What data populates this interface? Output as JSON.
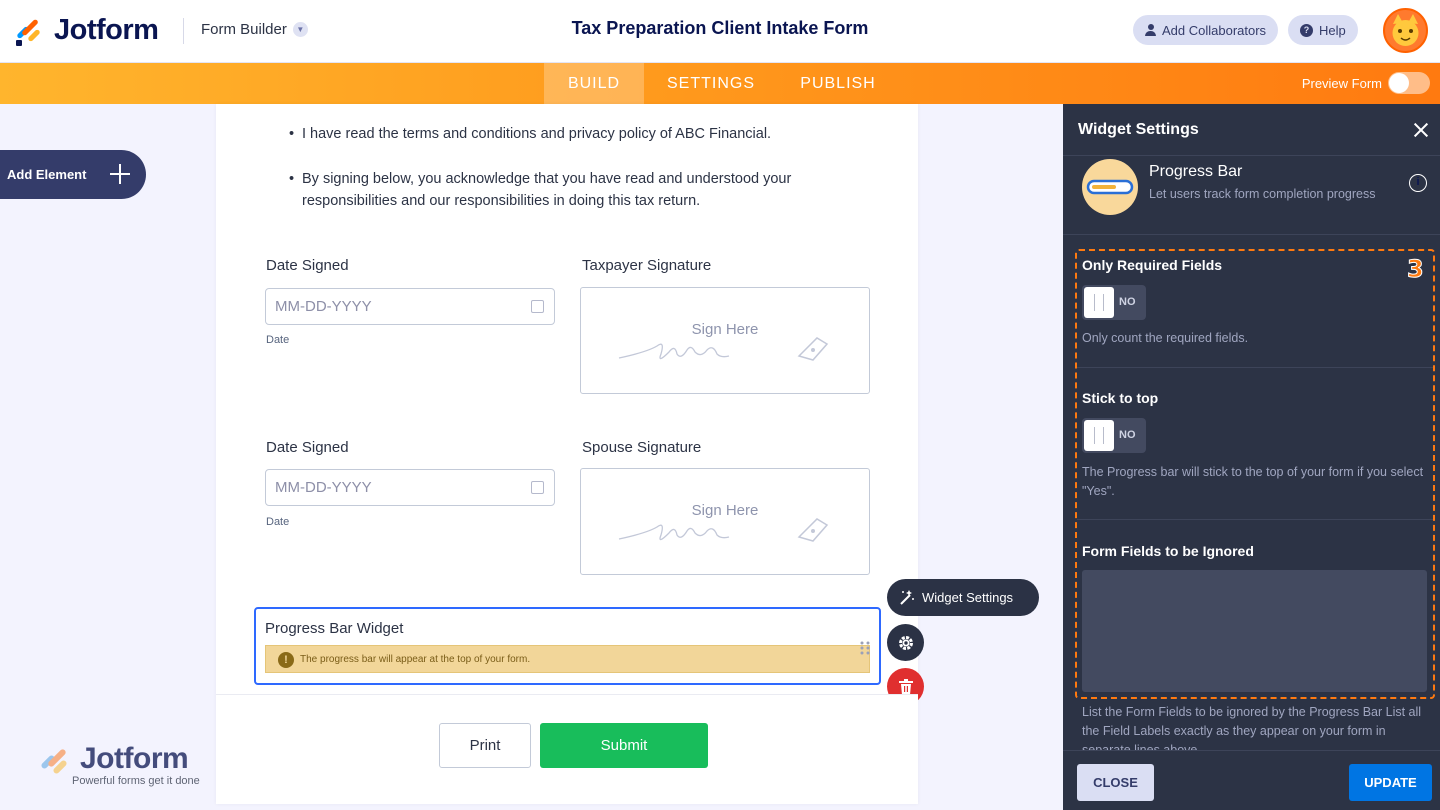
{
  "header": {
    "brand": "Jotform",
    "builder_label": "Form Builder",
    "form_title": "Tax Preparation Client Intake Form",
    "add_collaborators": "Add Collaborators",
    "help": "Help"
  },
  "nav": {
    "tabs": [
      "BUILD",
      "SETTINGS",
      "PUBLISH"
    ],
    "active_tab": "BUILD",
    "preview_label": "Preview Form"
  },
  "canvas": {
    "add_element": "Add Element",
    "bullets": [
      "I have read the terms and conditions and privacy policy of ABC Financial.",
      "By signing below, you acknowledge that you have read and understood your responsibilities and our responsibilities in doing this tax return."
    ],
    "rows": [
      {
        "date_label": "Date Signed",
        "date_placeholder": "MM-DD-YYYY",
        "date_sub": "Date",
        "sig_label": "Taxpayer Signature",
        "sig_placeholder": "Sign Here"
      },
      {
        "date_label": "Date Signed",
        "date_placeholder": "MM-DD-YYYY",
        "date_sub": "Date",
        "sig_label": "Spouse Signature",
        "sig_placeholder": "Sign Here"
      }
    ],
    "widget": {
      "title": "Progress Bar Widget",
      "warning": "The progress bar will appear at the top of your form.",
      "settings_button": "Widget Settings"
    },
    "print": "Print",
    "submit": "Submit",
    "watermark_brand": "Jotform",
    "watermark_tagline": "Powerful forms get it done"
  },
  "panel": {
    "title": "Widget Settings",
    "widget_name": "Progress Bar",
    "widget_desc": "Let users track form completion progress",
    "step_marker": "3",
    "settings": [
      {
        "label": "Only Required Fields",
        "toggle": "NO",
        "help": "Only count the required fields."
      },
      {
        "label": "Stick to top",
        "toggle": "NO",
        "help": "The Progress bar will stick to the top of your form if you select \"Yes\"."
      }
    ],
    "ignored_label": "Form Fields to be Ignored",
    "ignored_value": "",
    "ignored_help": "List the Form Fields to be ignored by the Progress Bar List all the Field Labels exactly as they appear on your form in separate lines above.",
    "close": "CLOSE",
    "update": "UPDATE"
  },
  "colors": {
    "accent_orange": "#ff7a10",
    "panel_bg": "#2c3345",
    "submit_green": "#18bd5b",
    "update_blue": "#0075e3",
    "selected_border": "#2e69ff"
  }
}
